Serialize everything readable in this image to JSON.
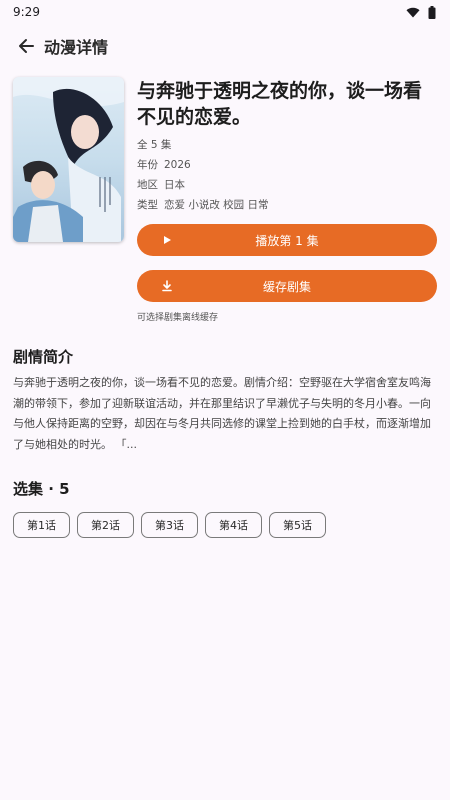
{
  "status_bar": {
    "time": "9:29",
    "icons": [
      "wifi-icon",
      "battery-icon"
    ]
  },
  "app_bar": {
    "title": "动漫详情",
    "back_icon": "arrow-back-icon"
  },
  "detail": {
    "title": "与奔驰于透明之夜的你，谈一场看不见的恋爱。",
    "episodes_count": "全 5 集",
    "year_label": "年份",
    "year": "2026",
    "region_label": "地区",
    "region": "日本",
    "genre_label": "类型",
    "genres": "恋爱 小说改 校园 日常"
  },
  "actions": {
    "play_label": "播放第 1 集",
    "play_icon": "play-icon",
    "download_label": "缓存剧集",
    "download_icon": "download-icon",
    "hint": "可选择剧集离线缓存"
  },
  "synopsis": {
    "heading": "剧情简介",
    "text": "与奔驰于透明之夜的你，谈一场看不见的恋爱。剧情介绍：空野驱在大学宿舍室友鸣海潮的带领下，参加了迎新联谊活动，并在那里结识了早濑优子与失明的冬月小春。一向与他人保持距离的空野，却因在与冬月共同选修的课堂上捡到她的白手杖，而逐渐增加了与她相处的时光。 「..."
  },
  "episodes": {
    "heading": "选集 · 5",
    "items": [
      "第1话",
      "第2话",
      "第3话",
      "第4话",
      "第5话"
    ]
  },
  "colors": {
    "accent": "#e76b25",
    "background": "#fcf8fd"
  }
}
